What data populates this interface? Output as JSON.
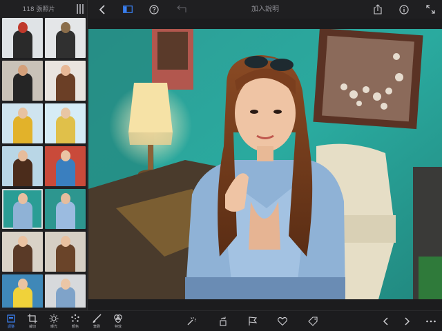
{
  "sidebar": {
    "photo_count": "118 張照片",
    "thumbnails": [
      {
        "bg": "#dfe3e6",
        "fig": "#2a2a2a",
        "accent": "#c0392b"
      },
      {
        "bg": "#e4e6e8",
        "fig": "#303030",
        "accent": "#8a6d4a"
      },
      {
        "bg": "#c9c2b8",
        "fig": "#252525",
        "accent": "#d4a07a"
      },
      {
        "bg": "#e9e4df",
        "fig": "#6b3f26",
        "accent": "#e8b896"
      },
      {
        "bg": "#cfe4ef",
        "fig": "#e2b22a",
        "accent": "#e8c2a0"
      },
      {
        "bg": "#d6ecf6",
        "fig": "#e0c04a",
        "accent": "#e9c6a4"
      },
      {
        "bg": "#b9d6e6",
        "fig": "#4b2c1b",
        "accent": "#e6bc9c"
      },
      {
        "bg": "#c94a3a",
        "fig": "#3a7fbf",
        "accent": "#ebc4a3"
      },
      {
        "bg": "#2a9d95",
        "fig": "#8fb2d6",
        "accent": "#e8bfa0"
      },
      {
        "bg": "#2d968f",
        "fig": "#9bbbe0",
        "accent": "#e6bd9d"
      },
      {
        "bg": "#d9d2c7",
        "fig": "#5a3a27",
        "accent": "#ebc3a2"
      },
      {
        "bg": "#d6cfc4",
        "fig": "#6a4429",
        "accent": "#e9c19f"
      },
      {
        "bg": "#3f88b8",
        "fig": "#f0d23a",
        "accent": "#eac3a1"
      },
      {
        "bg": "#d7d9dc",
        "fig": "#7fa3c9",
        "accent": "#ebc6a6"
      }
    ],
    "selected_index": 8
  },
  "topbar": {
    "title": "加入說明"
  },
  "toolbar": {
    "tools": [
      {
        "name": "adjust",
        "label": "調整",
        "active": true
      },
      {
        "name": "crop",
        "label": "裁切",
        "active": false
      },
      {
        "name": "exposure",
        "label": "曝光",
        "active": false
      },
      {
        "name": "color",
        "label": "顏色",
        "active": false
      },
      {
        "name": "brush",
        "label": "筆刷",
        "active": false
      },
      {
        "name": "effects",
        "label": "特效",
        "active": false
      }
    ]
  },
  "colors": {
    "accent": "#3a82f7",
    "wall": "#2aa69c",
    "table": "#4a3b2c"
  }
}
